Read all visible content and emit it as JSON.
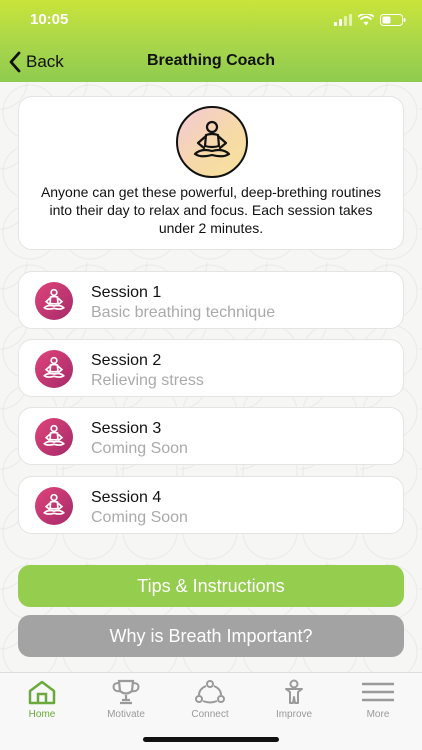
{
  "status": {
    "time": "10:05"
  },
  "nav": {
    "back_label": "Back",
    "title": "Breathing Coach"
  },
  "intro": {
    "text": "Anyone can get these powerful, deep-brething routines into their day to relax and focus. Each session takes under 2 minutes."
  },
  "sessions": [
    {
      "title": "Session 1",
      "subtitle": "Basic breathing technique"
    },
    {
      "title": "Session 2",
      "subtitle": "Relieving stress"
    },
    {
      "title": "Session 3",
      "subtitle": "Coming Soon"
    },
    {
      "title": "Session 4",
      "subtitle": "Coming Soon"
    }
  ],
  "buttons": {
    "tips": "Tips & Instructions",
    "why": "Why is Breath Important?"
  },
  "tabbar": {
    "items": [
      {
        "label": "Home",
        "icon": "home-icon",
        "active": true
      },
      {
        "label": "Motivate",
        "icon": "trophy-icon",
        "active": false
      },
      {
        "label": "Connect",
        "icon": "connect-icon",
        "active": false
      },
      {
        "label": "Improve",
        "icon": "person-icon",
        "active": false
      },
      {
        "label": "More",
        "icon": "menu-icon",
        "active": false
      }
    ]
  },
  "colors": {
    "header_top": "#c9e43a",
    "header_bottom": "#8fcb4f",
    "tips_button": "#95cd4f",
    "why_button": "#a3a3a3",
    "session_icon": "#d03a72",
    "active_tab": "#6aaa3a"
  }
}
